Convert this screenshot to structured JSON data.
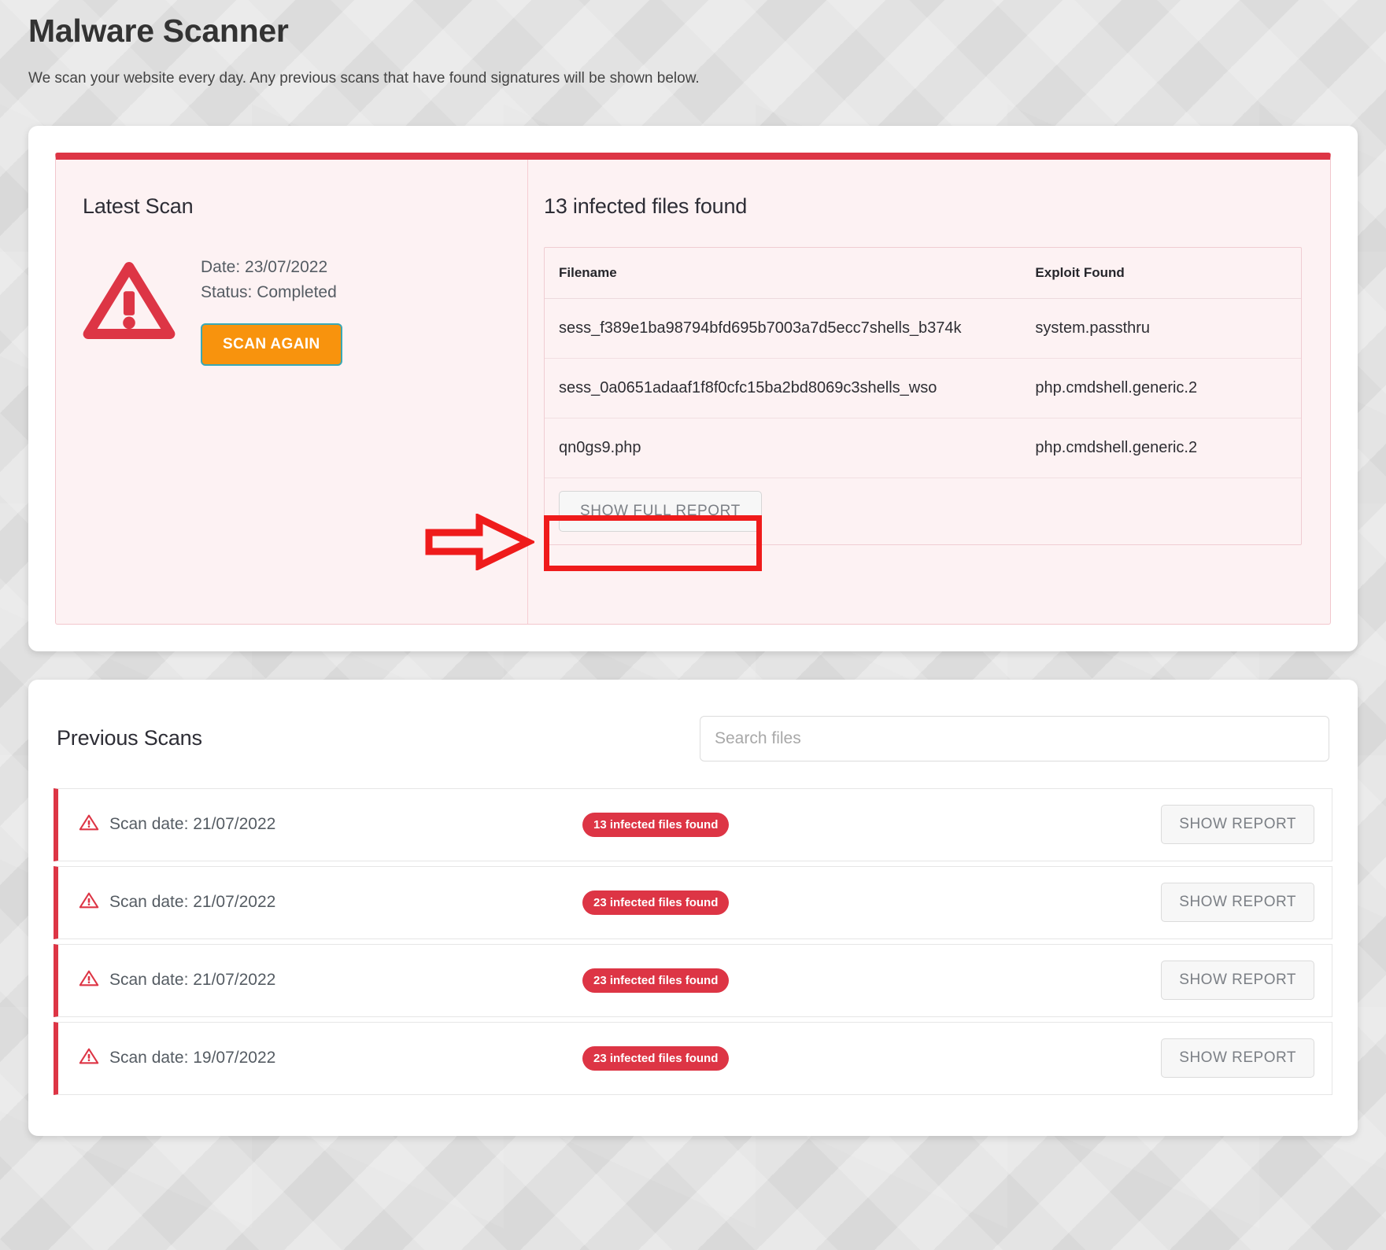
{
  "header": {
    "title": "Malware Scanner",
    "subtitle": "We scan your website every day. Any previous scans that have found signatures will be shown below."
  },
  "colors": {
    "danger": "#dd3545",
    "annotation": "#ef1b1b",
    "accent_orange": "#f8930d",
    "accent_teal": "#3aa8b5",
    "alert_bg": "#fdf2f3"
  },
  "latest_scan": {
    "heading": "Latest Scan",
    "warning_icon": "warning-triangle-icon",
    "date_line": "Date: 23/07/2022",
    "status_line": "Status: Completed",
    "scan_again_label": "SCAN AGAIN"
  },
  "infected": {
    "title": "13 infected files found",
    "columns": [
      "Filename",
      "Exploit Found"
    ],
    "rows": [
      {
        "filename": "sess_f389e1ba98794bfd695b7003a7d5ecc7shells_b374k",
        "exploit": "system.passthru"
      },
      {
        "filename": "sess_0a0651adaaf1f8f0cfc15ba2bd8069c3shells_wso",
        "exploit": "php.cmdshell.generic.2"
      },
      {
        "filename": "qn0gs9.php",
        "exploit": "php.cmdshell.generic.2"
      }
    ],
    "show_full_report_label": "SHOW FULL REPORT"
  },
  "annotation": {
    "arrow_icon": "right-arrow-annotation-icon",
    "highlight_target": "show-full-report-button"
  },
  "previous_scans": {
    "heading": "Previous Scans",
    "search_placeholder": "Search files",
    "search_value": "",
    "show_report_label": "SHOW REPORT",
    "rows": [
      {
        "date": "Scan date: 21/07/2022",
        "badge": "13 infected files found",
        "icon": "warning-triangle-icon"
      },
      {
        "date": "Scan date: 21/07/2022",
        "badge": "23 infected files found",
        "icon": "warning-triangle-icon"
      },
      {
        "date": "Scan date: 21/07/2022",
        "badge": "23 infected files found",
        "icon": "warning-triangle-icon"
      },
      {
        "date": "Scan date: 19/07/2022",
        "badge": "23 infected files found",
        "icon": "warning-triangle-icon"
      }
    ]
  }
}
